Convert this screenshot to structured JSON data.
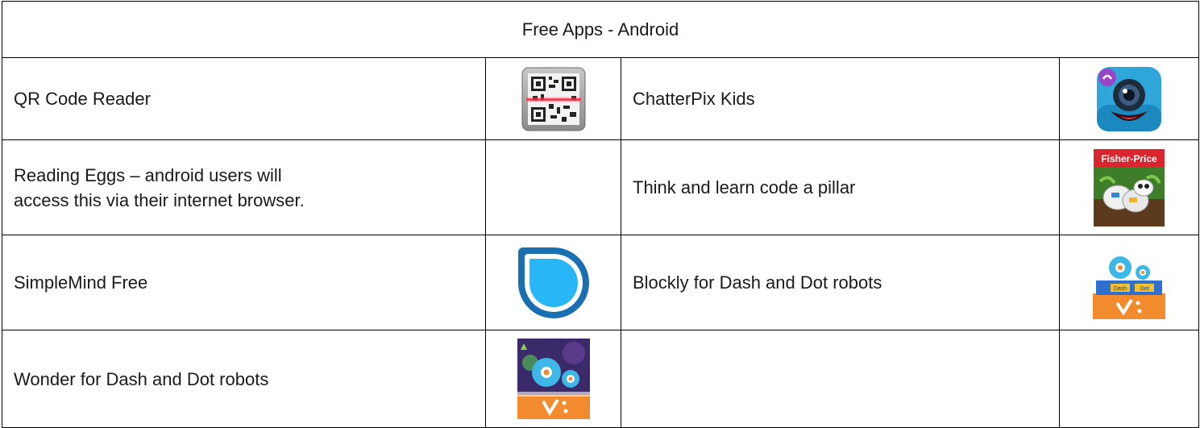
{
  "table": {
    "title": "Free Apps - Android",
    "rows": [
      {
        "left": {
          "name": "QR Code Reader",
          "icon": "qr-code-icon"
        },
        "right": {
          "name": "ChatterPix Kids",
          "icon": "chatterpix-icon"
        }
      },
      {
        "left": {
          "name_line1": "Reading Eggs – android users will",
          "name_line2": "access this via their internet browser.",
          "icon": ""
        },
        "right": {
          "name": "Think and learn code a pillar",
          "icon": "code-a-pillar-icon",
          "brand_text": "Fisher-Price"
        }
      },
      {
        "left": {
          "name": "SimpleMind Free",
          "icon": "simplemind-icon"
        },
        "right": {
          "name": "Blockly for Dash and Dot robots",
          "icon": "blockly-icon",
          "badge_left": "Dash",
          "badge_right": "Dot"
        }
      },
      {
        "left": {
          "name": "Wonder for Dash and Dot robots",
          "icon": "wonder-icon"
        },
        "right": {
          "name": "",
          "icon": ""
        }
      }
    ]
  }
}
